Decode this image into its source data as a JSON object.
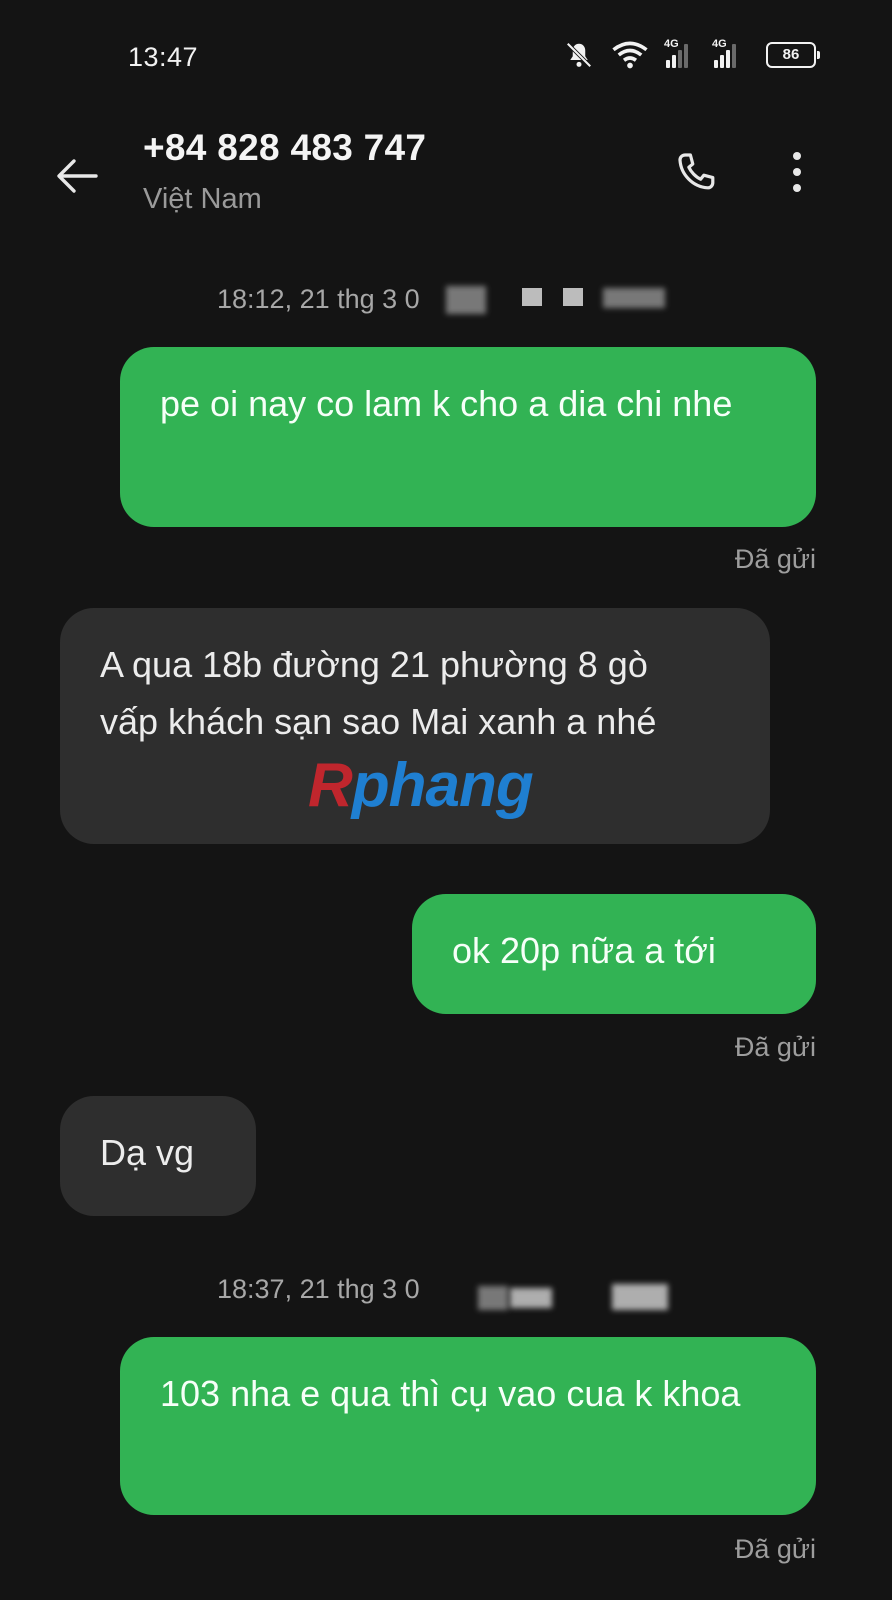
{
  "status_bar": {
    "time": "13:47",
    "network_1": "4G",
    "network_2": "4G",
    "battery": "86",
    "icons": [
      "bell-muted-icon",
      "wifi-icon",
      "signal-icon",
      "signal-icon",
      "battery-icon"
    ]
  },
  "header": {
    "contact_number": "+84 828 483 747",
    "contact_country": "Việt Nam",
    "icons": [
      "back-arrow-icon",
      "phone-icon",
      "more-vertical-icon"
    ]
  },
  "conversation": {
    "timestamp_1": "18:12, 21 thg 3 0",
    "timestamp_2": "18:37, 21 thg 3 0",
    "messages": [
      {
        "direction": "outgoing",
        "text": "pe oi nay co lam k cho a dia chi nhe",
        "status": "Đã gửi"
      },
      {
        "direction": "incoming",
        "text": "A qua 18b đường 21 phường 8 gò vấp khách sạn sao Mai xanh a nhé"
      },
      {
        "direction": "outgoing",
        "text": "ok 20p nữa a tới",
        "status": "Đã gửi"
      },
      {
        "direction": "incoming",
        "text": "Dạ vg"
      },
      {
        "direction": "outgoing",
        "text": "103 nha e qua thì cụ vao cua k khoa",
        "status": "Đã gửi"
      }
    ]
  },
  "watermark": {
    "first": "R",
    "rest": "phang"
  },
  "colors": {
    "background": "#141414",
    "outgoing_bubble": "#32b354",
    "incoming_bubble": "#2e2e2e",
    "secondary_text": "#9a9a9a"
  }
}
